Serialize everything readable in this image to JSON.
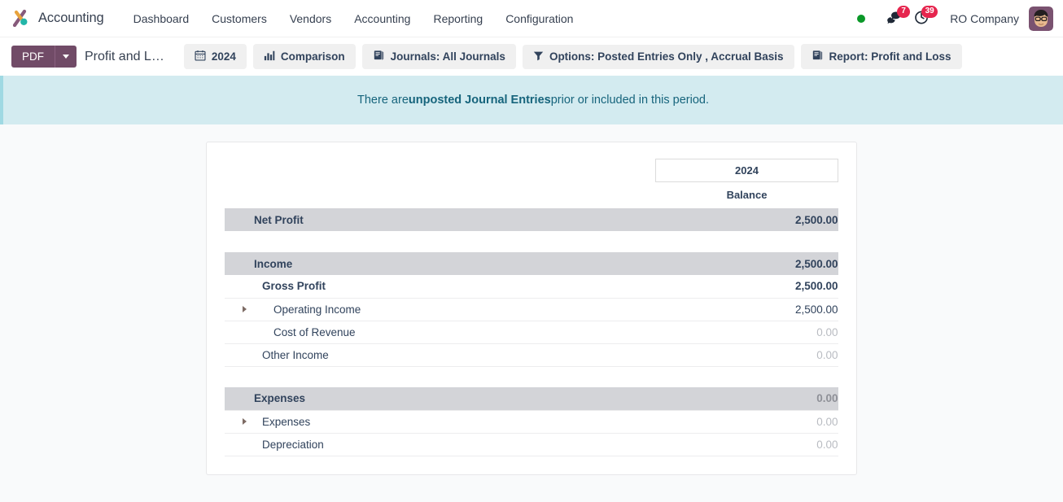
{
  "navbar": {
    "brand": "Accounting",
    "brand_logo_icon": "odoo-accounting-logo-icon",
    "menu": [
      {
        "label": "Dashboard"
      },
      {
        "label": "Customers"
      },
      {
        "label": "Vendors"
      },
      {
        "label": "Accounting"
      },
      {
        "label": "Reporting"
      },
      {
        "label": "Configuration"
      }
    ],
    "status_indicator_color": "#0a9828",
    "messages": {
      "icon": "chat-bubble-icon",
      "count": "7",
      "badge_color": "#e6254e"
    },
    "activities": {
      "icon": "clock-icon",
      "count": "39",
      "badge_color": "#e6254e"
    },
    "company": "RO Company",
    "avatar_icon": "user-avatar-icon"
  },
  "control_bar": {
    "pdf_label": "PDF",
    "pdf_caret_icon": "chevron-down-icon",
    "report_title": "Profit and L…",
    "filters": [
      {
        "label": "2024",
        "icon": "calendar-icon"
      },
      {
        "label": "Comparison",
        "icon": "bar-chart-icon"
      },
      {
        "label": "Journals: All Journals",
        "icon": "book-icon"
      },
      {
        "label": "Options: Posted Entries Only , Accrual Basis",
        "icon": "filter-funnel-icon"
      },
      {
        "label": "Report: Profit and Loss",
        "icon": "book-icon"
      }
    ]
  },
  "alert": {
    "prefix": "There are ",
    "strong": "unposted Journal Entries",
    "suffix": " prior or included in this period."
  },
  "report": {
    "period_header": "2024",
    "column_header": "Balance",
    "rows": [
      {
        "type": "row",
        "name": "Net Profit",
        "value": "2,500.00",
        "level": 0,
        "shaded": true,
        "bold": true,
        "muted": false,
        "expandable": false
      },
      {
        "type": "spacer"
      },
      {
        "type": "row",
        "name": "Income",
        "value": "2,500.00",
        "level": 0,
        "shaded": true,
        "bold": true,
        "muted": false,
        "expandable": false
      },
      {
        "type": "row",
        "name": "Gross Profit",
        "value": "2,500.00",
        "level": 1,
        "shaded": false,
        "bold": true,
        "muted": false,
        "expandable": false
      },
      {
        "type": "row",
        "name": "Operating Income",
        "value": "2,500.00",
        "level": 2,
        "shaded": false,
        "bold": false,
        "muted": false,
        "expandable": true
      },
      {
        "type": "row",
        "name": "Cost of Revenue",
        "value": "0.00",
        "level": 2,
        "shaded": false,
        "bold": false,
        "muted": true,
        "expandable": false
      },
      {
        "type": "row",
        "name": "Other Income",
        "value": "0.00",
        "level": 1,
        "shaded": false,
        "bold": false,
        "muted": true,
        "expandable": false
      },
      {
        "type": "spacer"
      },
      {
        "type": "row",
        "name": "Expenses",
        "value": "0.00",
        "level": 0,
        "shaded": true,
        "bold": true,
        "muted": true,
        "expandable": false
      },
      {
        "type": "row",
        "name": "Expenses",
        "value": "0.00",
        "level": 1,
        "shaded": false,
        "bold": false,
        "muted": true,
        "expandable": true
      },
      {
        "type": "row",
        "name": "Depreciation",
        "value": "0.00",
        "level": 1,
        "shaded": false,
        "bold": false,
        "muted": true,
        "expandable": false
      }
    ]
  }
}
